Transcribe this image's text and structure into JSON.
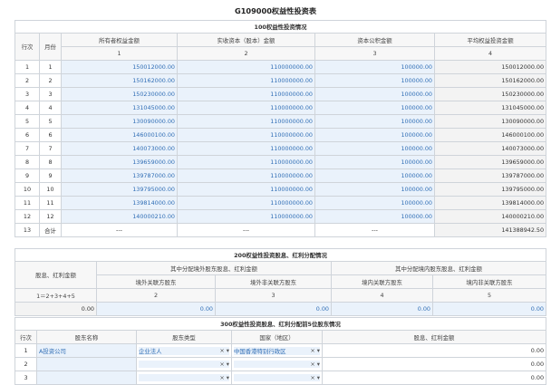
{
  "title": "G109000权益性投资表",
  "s100": {
    "heading": "100权益性投资情况",
    "h": {
      "row": "行次",
      "month": "月份",
      "col1": "所有者权益金额",
      "col2": "实收资本（股本）金额",
      "col3": "资本公积金额",
      "col4": "平均权益投资金额"
    },
    "n": {
      "c1": "1",
      "c2": "2",
      "c3": "3",
      "c4": "4"
    },
    "rows": [
      {
        "no": "1",
        "m": "1",
        "a": "150012000.00",
        "b": "110000000.00",
        "c": "100000.00",
        "d": "150012000.00"
      },
      {
        "no": "2",
        "m": "2",
        "a": "150162000.00",
        "b": "110000000.00",
        "c": "100000.00",
        "d": "150162000.00"
      },
      {
        "no": "3",
        "m": "3",
        "a": "150230000.00",
        "b": "110000000.00",
        "c": "100000.00",
        "d": "150230000.00"
      },
      {
        "no": "4",
        "m": "4",
        "a": "131045000.00",
        "b": "110000000.00",
        "c": "100000.00",
        "d": "131045000.00"
      },
      {
        "no": "5",
        "m": "5",
        "a": "130090000.00",
        "b": "110000000.00",
        "c": "100000.00",
        "d": "130090000.00"
      },
      {
        "no": "6",
        "m": "6",
        "a": "146000100.00",
        "b": "110000000.00",
        "c": "100000.00",
        "d": "146000100.00"
      },
      {
        "no": "7",
        "m": "7",
        "a": "140073000.00",
        "b": "110000000.00",
        "c": "100000.00",
        "d": "140073000.00"
      },
      {
        "no": "8",
        "m": "8",
        "a": "139659000.00",
        "b": "110000000.00",
        "c": "100000.00",
        "d": "139659000.00"
      },
      {
        "no": "9",
        "m": "9",
        "a": "139787000.00",
        "b": "110000000.00",
        "c": "100000.00",
        "d": "139787000.00"
      },
      {
        "no": "10",
        "m": "10",
        "a": "139795000.00",
        "b": "110000000.00",
        "c": "100000.00",
        "d": "139795000.00"
      },
      {
        "no": "11",
        "m": "11",
        "a": "139814000.00",
        "b": "110000000.00",
        "c": "100000.00",
        "d": "139814000.00"
      },
      {
        "no": "12",
        "m": "12",
        "a": "140000210.00",
        "b": "110000000.00",
        "c": "100000.00",
        "d": "140000210.00"
      }
    ],
    "total": {
      "no": "13",
      "m": "合计",
      "a": "---",
      "b": "---",
      "c": "---",
      "d": "141388942.50"
    }
  },
  "s200": {
    "heading": "200权益性投资股息、红利分配情况",
    "colA": "股息、红利金额",
    "grpB": "其中分配境外股东股息、红利金额",
    "grpC": "其中分配境内股东股息、红利金额",
    "b1": "境外关联方股东",
    "b2": "境外非关联方股东",
    "c1": "境内关联方股东",
    "c2": "境内非关联方股东",
    "formula": "1＝2+3+4+5",
    "n2": "2",
    "n3": "3",
    "n4": "4",
    "n5": "5",
    "vals": [
      "0.00",
      "0.00",
      "0.00",
      "0.00",
      "0.00"
    ]
  },
  "s300": {
    "heading": "300权益性投资股息、红利分配前5位股东情况",
    "h": {
      "row": "行次",
      "name": "股东名称",
      "type": "股东类型",
      "country": "国家（地区）",
      "amount": "股息、红利金额"
    },
    "rows": [
      {
        "no": "1",
        "name": "A投资公司",
        "type": "企业法人",
        "country": "中国香港特别行政区",
        "amount": "0.00"
      },
      {
        "no": "2",
        "name": "",
        "type": "",
        "country": "",
        "amount": "0.00"
      },
      {
        "no": "3",
        "name": "",
        "type": "",
        "country": "",
        "amount": "0.00"
      }
    ],
    "ctl": "× ▾"
  }
}
